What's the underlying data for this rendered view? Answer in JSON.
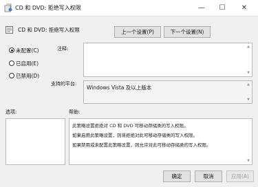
{
  "window": {
    "title": "CD 和 DVD: 拒绝写入权限",
    "controls": [
      "minimize-icon",
      "maximize-icon",
      "close-icon"
    ]
  },
  "policy": {
    "name": "CD 和 DVD: 拒绝写入权限"
  },
  "nav": {
    "prev_label": "上一个设置(P)",
    "next_label": "下一个设置(N)"
  },
  "radios": [
    {
      "label": "未配置(C)",
      "checked": true
    },
    {
      "label": "已启用(E)",
      "checked": false
    },
    {
      "label": "已禁用(D)",
      "checked": false
    }
  ],
  "comment": {
    "label": "注释:",
    "value": ""
  },
  "supported": {
    "label": "支持的平台:",
    "value": "Windows Vista 及以上版本"
  },
  "options": {
    "label": "选项:"
  },
  "help": {
    "label": "帮助:",
    "paragraphs": [
      "此策略设置拒绝对 CD 和 DVD 可移动存储类的写入权限。",
      "如果启用此策略设置，则将拒绝对此可移动存储类的写入权限。",
      "如果禁用或未配置此策略设置，则允许对此可移动存储类的写入权限。"
    ]
  },
  "footer": {
    "ok_label": "确定",
    "cancel_label": "取消",
    "apply_label": "应用(A)"
  }
}
